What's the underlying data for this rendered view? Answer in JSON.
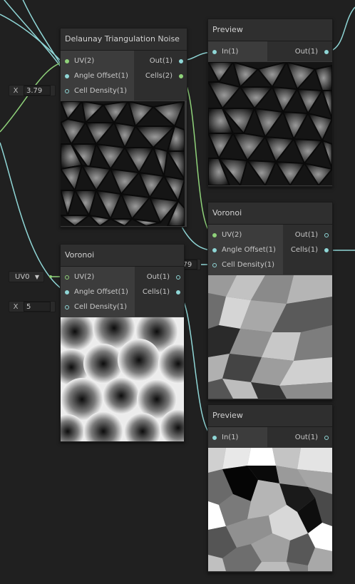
{
  "nodes": {
    "delaunay": {
      "title": "Delaunay Triangulation Noise",
      "inputs": [
        "UV(2)",
        "Angle Offset(1)",
        "Cell Density(1)"
      ],
      "outputs": [
        "Out(1)",
        "Cells(2)"
      ]
    },
    "preview1": {
      "title": "Preview",
      "inputs": [
        "In(1)"
      ],
      "outputs": [
        "Out(1)"
      ]
    },
    "voronoi_right": {
      "title": "Voronoi",
      "inputs": [
        "UV(2)",
        "Angle Offset(1)",
        "Cell Density(1)"
      ],
      "outputs": [
        "Out(1)",
        "Cells(1)"
      ]
    },
    "voronoi_left": {
      "title": "Voronoi",
      "inputs": [
        "UV(2)",
        "Angle Offset(1)",
        "Cell Density(1)"
      ],
      "outputs": [
        "Out(1)",
        "Cells(1)"
      ]
    },
    "preview2": {
      "title": "Preview",
      "inputs": [
        "In(1)"
      ],
      "outputs": [
        "Out(1)"
      ]
    }
  },
  "fields": {
    "delaunay_density": {
      "axis": "X",
      "value": "3.79"
    },
    "voronoi_right_density": {
      "axis": "X",
      "value": "3.79"
    },
    "voronoi_left_uv": {
      "value": "UV0"
    },
    "voronoi_left_density": {
      "axis": "X",
      "value": "5"
    }
  },
  "colors": {
    "wire_float": "#8fd6d6",
    "wire_vector2": "#8fd27a",
    "canvas": "#202020"
  }
}
